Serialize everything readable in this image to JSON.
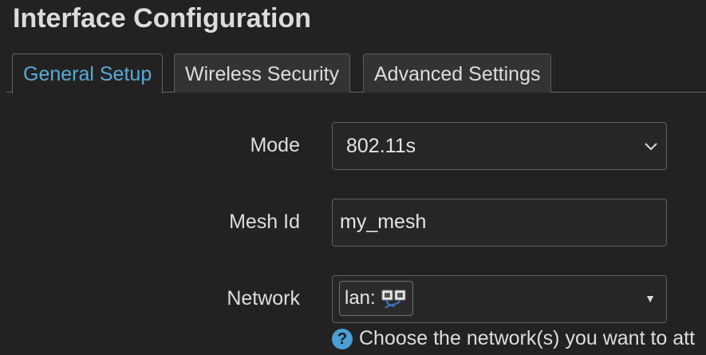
{
  "page": {
    "title": "Interface Configuration"
  },
  "tabs": [
    {
      "label": "General Setup",
      "active": true
    },
    {
      "label": "Wireless Security",
      "active": false
    },
    {
      "label": "Advanced Settings",
      "active": false
    }
  ],
  "form": {
    "mode": {
      "label": "Mode",
      "value": "802.11s"
    },
    "mesh_id": {
      "label": "Mesh Id",
      "value": "my_mesh"
    },
    "network": {
      "label": "Network",
      "selected_tag": "lan:",
      "tag_icon": "network-ports-icon",
      "help_text": "Choose the network(s) you want to att"
    }
  },
  "colors": {
    "background": "#222222",
    "accent": "#5aa9d6",
    "help_icon": "#4a9fd4"
  }
}
